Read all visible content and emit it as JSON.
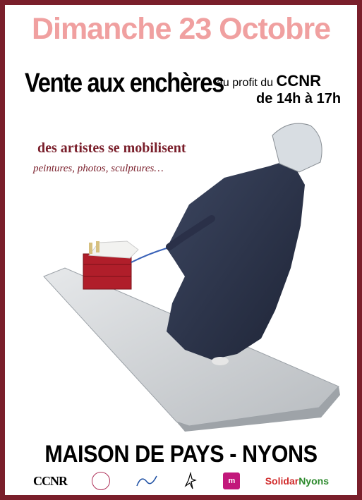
{
  "header": {
    "date": "Dimanche 23 Octobre",
    "title": "Vente aux enchères",
    "beneficiary_prefix": "au profit du",
    "beneficiary": "CCNR",
    "hours": "de 14h à 17h"
  },
  "tagline": {
    "main": "des artistes se mobilisent",
    "works": "peintures, photos, sculptures…"
  },
  "venue": "MAISON DE PAYS - NYONS",
  "logos": {
    "ccnr": "CCNR",
    "solidar_a": "Solidar",
    "solidar_b": "Nyons",
    "radio": "m"
  },
  "colors": {
    "border": "#7a1f2b",
    "date": "#f0a0a0",
    "accent": "#7a1f2b"
  }
}
